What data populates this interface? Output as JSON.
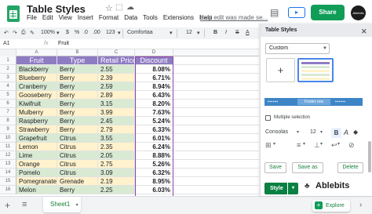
{
  "header": {
    "title": "Table Styles",
    "menu": [
      "File",
      "Edit",
      "View",
      "Insert",
      "Format",
      "Data",
      "Tools",
      "Extensions",
      "Help"
    ],
    "last_edit": "Last edit was made se...",
    "share_label": "Share",
    "avatar_label": "Ablebits"
  },
  "toolbar": {
    "zoom": "100%",
    "currency": "$",
    "percent": "%",
    "decimal_dec": ".0",
    "decimal_inc": ".00",
    "more_formats": "123",
    "font": "Comfortaa",
    "font_size": "12"
  },
  "formula_bar": {
    "name_box": "A1",
    "fx": "fx",
    "value": "Fruit"
  },
  "grid": {
    "columns": [
      "A",
      "B",
      "C",
      "D"
    ],
    "headers": [
      "Fruit",
      "Type",
      "Retail Price",
      "Discount"
    ],
    "rows": [
      [
        "Blackberry",
        "Berry",
        "2.55",
        "8.08%"
      ],
      [
        "Blueberry",
        "Berry",
        "2.39",
        "6.71%"
      ],
      [
        "Cranberry",
        "Berry",
        "2.59",
        "8.94%"
      ],
      [
        "Gooseberry",
        "Berry",
        "2.89",
        "6.43%"
      ],
      [
        "Kiwifruit",
        "Berry",
        "3.15",
        "8.20%"
      ],
      [
        "Mulberry",
        "Berry",
        "3.99",
        "7.63%"
      ],
      [
        "Raspberry",
        "Berry",
        "2.45",
        "5.24%"
      ],
      [
        "Strawberry",
        "Berry",
        "2.79",
        "6.33%"
      ],
      [
        "Grapefruit",
        "Citrus",
        "3.55",
        "6.01%"
      ],
      [
        "Lemon",
        "Citrus",
        "2.35",
        "6.24%"
      ],
      [
        "Lime",
        "Citrus",
        "2.05",
        "8.88%"
      ],
      [
        "Orange",
        "Citrus",
        "2.75",
        "5.26%"
      ],
      [
        "Pomelo",
        "Citrus",
        "3.09",
        "6.32%"
      ],
      [
        "Pomegranate",
        "Grenade",
        "2.19",
        "8.95%"
      ],
      [
        "Melon",
        "Berry",
        "2.25",
        "6.03%"
      ]
    ],
    "row_numbers": [
      "1",
      "2",
      "3",
      "4",
      "5",
      "6",
      "7",
      "8",
      "9",
      "10",
      "11",
      "12",
      "13",
      "14",
      "15",
      "16"
    ]
  },
  "sheets": {
    "add": "+",
    "all": "≡",
    "active": "Sheet1",
    "explore": "Explore"
  },
  "panel": {
    "title": "Table Styles",
    "template_select": "Custom",
    "add_icon": "+",
    "footer_row_label": "Footer row",
    "multiple_selection": "Multiple selection",
    "font": "Consolas",
    "font_size": "12",
    "bold": "B",
    "save": "Save",
    "save_as": "Save as",
    "delete": "Delete",
    "style_button": "Style",
    "brand": "Ablebits"
  },
  "colors": {
    "header_fill": "#8e7cc3",
    "band_green": "#d9ead3",
    "band_yellow": "#fff2cc",
    "share_green": "#0f9d58",
    "selection_purple": "#8e44ad"
  }
}
